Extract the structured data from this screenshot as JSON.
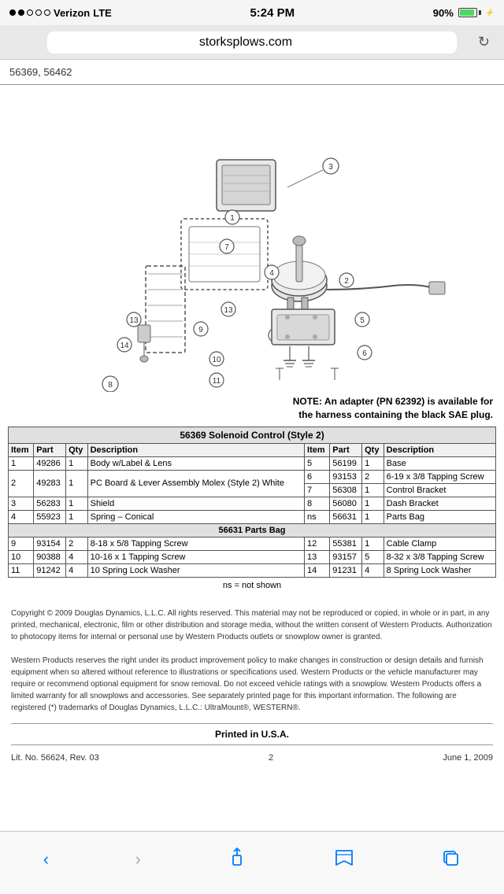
{
  "statusBar": {
    "carrier": "Verizon",
    "network": "LTE",
    "time": "5:24 PM",
    "battery": "90%",
    "dots": [
      true,
      true,
      false,
      false,
      false
    ]
  },
  "browser": {
    "url": "storksplows.com",
    "reload_label": "↻"
  },
  "page": {
    "partNumbers": "56369, 56462",
    "note": "NOTE: An adapter (PN 62392) is available for the harness containing the black SAE plug.",
    "table1": {
      "sectionHeader": "56369  Solenoid Control (Style 2)",
      "columns": [
        "Item",
        "Part",
        "Qty",
        "Description",
        "Item",
        "Part",
        "Qty",
        "Description"
      ],
      "rows": [
        [
          "1",
          "49286",
          "1",
          "Body w/Label & Lens",
          "5",
          "56199",
          "1",
          "Base"
        ],
        [
          "2",
          "49283",
          "1",
          "PC Board & Lever Assembly Molex (Style 2) White",
          "6",
          "93153",
          "2",
          "6-19 x 3/8 Tapping Screw"
        ],
        [
          "",
          "",
          "",
          "",
          "7",
          "56308",
          "1",
          "Control Bracket"
        ],
        [
          "3",
          "56283",
          "1",
          "Shield",
          "8",
          "56080",
          "1",
          "Dash Bracket"
        ],
        [
          "4",
          "55923",
          "1",
          "Spring – Conical",
          "ns",
          "56631",
          "1",
          "Parts Bag"
        ]
      ]
    },
    "table2": {
      "sectionHeader": "56631  Parts Bag",
      "rows": [
        [
          "9",
          "93154",
          "2",
          "8-18 x 5/8 Tapping Screw",
          "12",
          "55381",
          "1",
          "Cable Clamp"
        ],
        [
          "10",
          "90388",
          "4",
          "10-16 x 1 Tapping Screw",
          "13",
          "93157",
          "5",
          "8-32 x 3/8 Tapping Screw"
        ],
        [
          "11",
          "91242",
          "4",
          "10 Spring Lock Washer",
          "14",
          "91231",
          "4",
          "8 Spring Lock Washer"
        ]
      ]
    },
    "nsNote": "ns = not shown",
    "copyright": [
      "Copyright © 2009 Douglas Dynamics, L.L.C. All rights reserved. This material may not be reproduced or copied, in whole or in part, in any printed, mechanical, electronic, film or other distribution and storage media, without the written consent of Western Products. Authorization to photocopy items for internal or personal use by Western Products outlets or snowplow owner is granted.",
      "Western Products reserves the right under its product improvement policy to make changes in construction or design details and furnish equipment when so altered without reference to illustrations or specifications used. Western Products or the vehicle manufacturer may require or recommend optional equipment for snow removal. Do not exceed vehicle ratings with a snowplow. Western Products offers a limited warranty for all snowplows and accessories. See separately printed page for this important information. The following are registered (*) trademarks of Douglas Dynamics, L.L.C.: UltraMount®, WESTERN®."
    ],
    "printedInUSA": "Printed in U.S.A.",
    "footer": {
      "litNo": "Lit. No. 56624, Rev. 03",
      "pageNo": "2",
      "date": "June 1, 2009"
    }
  },
  "toolbar": {
    "back_label": "‹",
    "forward_label": "›",
    "share_label": "⬆",
    "bookmarks_label": "📖",
    "tabs_label": "⧉"
  }
}
